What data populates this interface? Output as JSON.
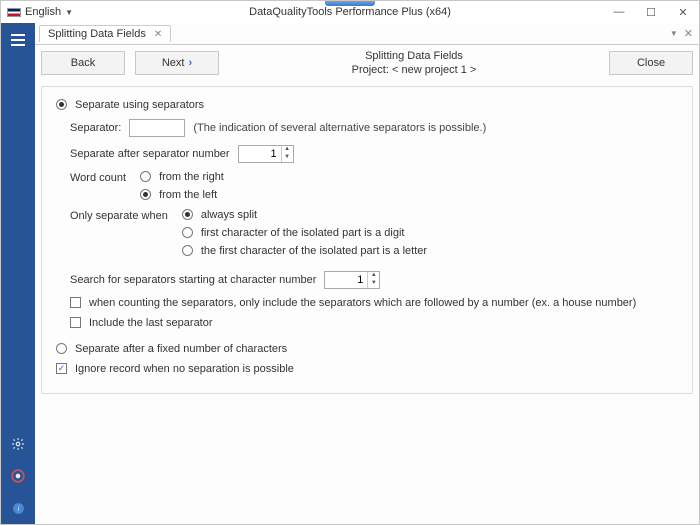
{
  "lang": "English",
  "window_title": "DataQualityTools Performance Plus (x64)",
  "tab_label": "Splitting Data Fields",
  "toolbar": {
    "back": "Back",
    "next": "Next",
    "close": "Close",
    "heading": "Splitting Data Fields",
    "project": "Project: < new project 1 >"
  },
  "options": {
    "mode_separators": "Separate using separators",
    "separator_label": "Separator:",
    "separator_hint": "(The indication of several alternative separators is possible.)",
    "sep_after_label": "Separate after separator number",
    "sep_after_value": "1",
    "word_count_label": "Word count",
    "from_right": "from the right",
    "from_left": "from the left",
    "only_separate_label": "Only separate when",
    "always_split": "always split",
    "first_digit": "first character of the isolated part is a digit",
    "first_letter": "the first character of the isolated part is a letter",
    "search_start_label": "Search for separators starting at character number",
    "search_start_value": "1",
    "only_numbered": "when counting the separators, only include the separators which are followed by a number (ex. a house number)",
    "include_last": "Include the last separator",
    "mode_fixed": "Separate after a fixed number of characters",
    "ignore_record": "Ignore record when no separation is possible"
  }
}
